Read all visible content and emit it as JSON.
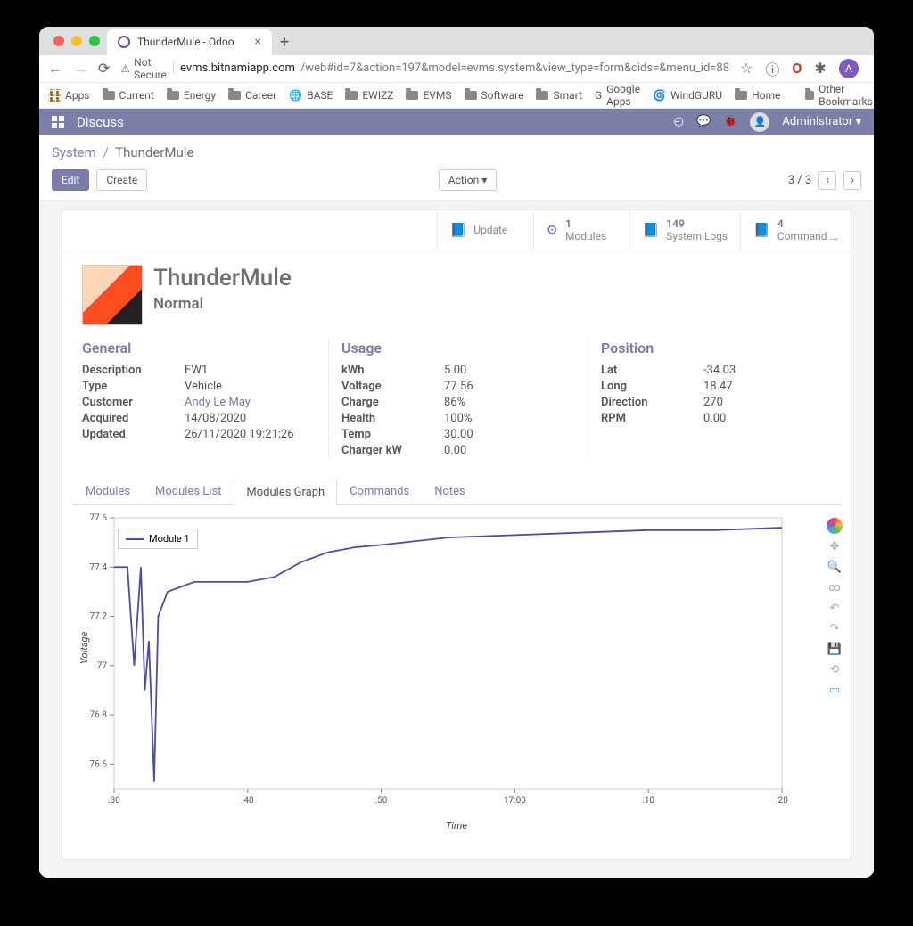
{
  "browser": {
    "tab_title": "ThunderMule - Odoo",
    "secure_label": "Not Secure",
    "url_host": "evms.bitnamiapp.com",
    "url_path": "/web#id=7&action=197&model=evms.system&view_type=form&cids=&menu_id=88",
    "avatar_letter": "A",
    "bookmarks": [
      "Apps",
      "Current",
      "Energy",
      "Career",
      "BASE",
      "EWIZZ",
      "EVMS",
      "Software",
      "Smart",
      "Google Apps",
      "WindGURU",
      "Home"
    ],
    "other_bookmarks": "Other Bookmarks"
  },
  "appbar": {
    "title": "Discuss",
    "user": "Administrator"
  },
  "crumb": {
    "root": "System",
    "current": "ThunderMule"
  },
  "buttons": {
    "edit": "Edit",
    "create": "Create",
    "action": "Action"
  },
  "pager": {
    "text": "3 / 3"
  },
  "stat": {
    "update": "Update",
    "modules_count": "1",
    "modules_label": "Modules",
    "logs_count": "149",
    "logs_label": "System Logs",
    "cmd_count": "4",
    "cmd_label": "Command ..."
  },
  "record": {
    "name": "ThunderMule",
    "state": "Normal"
  },
  "general": {
    "heading": "General",
    "Description": "EW1",
    "Type": "Vehicle",
    "Customer": "Andy Le May",
    "Acquired": "14/08/2020",
    "Updated": "26/11/2020 19:21:26"
  },
  "usage": {
    "heading": "Usage",
    "kWh": "5.00",
    "Voltage": "77.56",
    "Charge": "86%",
    "Health": "100%",
    "Temp": "30.00",
    "Charger_kW": "0.00"
  },
  "position": {
    "heading": "Position",
    "Lat": "-34.03",
    "Long": "18.47",
    "Direction": "270",
    "RPM": "0.00"
  },
  "tabs": {
    "modules": "Modules",
    "modules_list": "Modules List",
    "modules_graph": "Modules Graph",
    "commands": "Commands",
    "notes": "Notes"
  },
  "chart_data": {
    "type": "line",
    "title": "",
    "xlabel": "Time",
    "ylabel": "Voltage",
    "ylim": [
      76.5,
      77.6
    ],
    "x_ticks": [
      ":30",
      ":40",
      ":50",
      "17:00",
      ":10",
      ":20"
    ],
    "y_ticks": [
      76.6,
      76.8,
      77.0,
      77.2,
      77.4,
      77.6
    ],
    "series": [
      {
        "name": "Module 1",
        "x": [
          30,
          31,
          31.5,
          32,
          32.3,
          32.6,
          33,
          33.3,
          34,
          35,
          36,
          37,
          38,
          40,
          42,
          44,
          46,
          48,
          50,
          55,
          60,
          65,
          70,
          75,
          80
        ],
        "y": [
          77.4,
          77.4,
          77.0,
          77.4,
          76.9,
          77.1,
          76.53,
          77.2,
          77.3,
          77.32,
          77.34,
          77.34,
          77.34,
          77.34,
          77.36,
          77.42,
          77.46,
          77.48,
          77.49,
          77.52,
          77.53,
          77.54,
          77.55,
          77.55,
          77.56
        ]
      }
    ],
    "legend_label": "Module 1"
  }
}
